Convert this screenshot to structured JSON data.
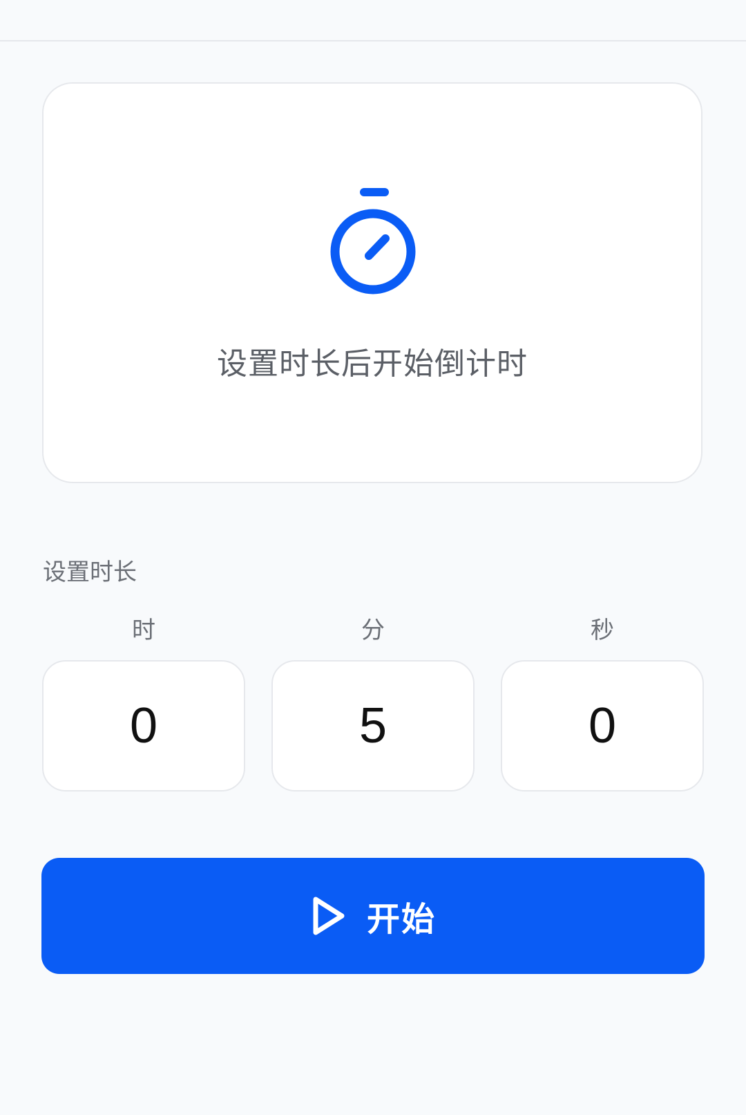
{
  "colors": {
    "page_background": "#f8fafc",
    "card_background": "#ffffff",
    "accent": "#0a5cf5",
    "text_secondary": "#6b6f76"
  },
  "status_card": {
    "icon": "stopwatch-icon",
    "message": "设置时长后开始倒计时"
  },
  "duration": {
    "section_label": "设置时长",
    "fields": [
      {
        "unit": "时",
        "value": "0"
      },
      {
        "unit": "分",
        "value": "5"
      },
      {
        "unit": "秒",
        "value": "0"
      }
    ]
  },
  "start_button": {
    "icon": "play-icon",
    "label": "开始"
  }
}
